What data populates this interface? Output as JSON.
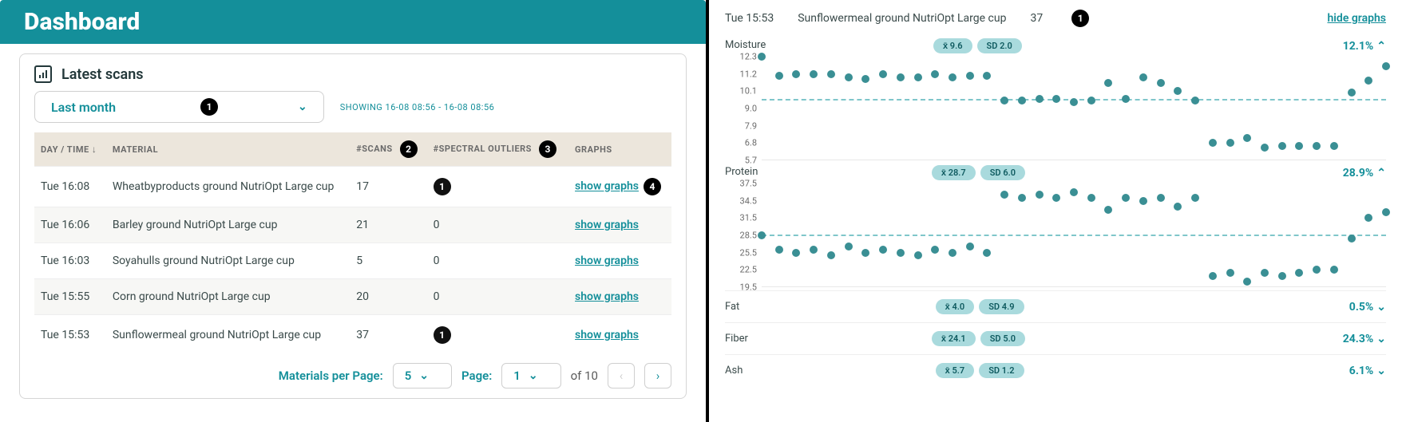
{
  "header": {
    "title": "Dashboard"
  },
  "panel": {
    "title": "Latest scans",
    "filter_label": "Last month",
    "showing_prefix": "SHOWING",
    "showing_range": "16-08 08:56 - 16-08 08:56"
  },
  "table": {
    "columns": {
      "daytime": "DAY / TIME",
      "material": "MATERIAL",
      "scans": "#SCANS",
      "outliers": "#SPECTRAL OUTLIERS",
      "graphs": "GRAPHS"
    },
    "graph_link_label": "show graphs",
    "rows": [
      {
        "daytime": "Tue 16:08",
        "material": "Wheatbyproducts ground NutriOpt Large cup",
        "scans": 17,
        "outliers": 1,
        "outlier_badge": true
      },
      {
        "daytime": "Tue 16:06",
        "material": "Barley ground NutriOpt Large cup",
        "scans": 21,
        "outliers": 0,
        "outlier_badge": false
      },
      {
        "daytime": "Tue 16:03",
        "material": "Soyahulls ground NutriOpt Large cup",
        "scans": 5,
        "outliers": 0,
        "outlier_badge": false
      },
      {
        "daytime": "Tue 15:55",
        "material": "Corn ground NutriOpt Large cup",
        "scans": 20,
        "outliers": 0,
        "outlier_badge": false
      },
      {
        "daytime": "Tue 15:53",
        "material": "Sunflowermeal ground NutriOpt Large cup",
        "scans": 37,
        "outliers": 1,
        "outlier_badge": true
      }
    ]
  },
  "pager": {
    "per_page_label": "Materials per Page:",
    "per_page_value": "5",
    "page_label": "Page:",
    "page_value": "1",
    "of_label": "of",
    "total_pages": "10"
  },
  "annotations": {
    "a1": "1",
    "a2": "2",
    "a3": "3",
    "a4": "4",
    "det_badge": "1"
  },
  "detail": {
    "daytime": "Tue 15:53",
    "material": "Sunflowermeal ground NutriOpt Large cup",
    "scans": "37",
    "hide_label": "hide graphs"
  },
  "charts": {
    "moisture": {
      "title": "Moisture",
      "mean_label": "x̄ 9.6",
      "sd_label": "SD 2.0",
      "summary": "12.1%",
      "y_ticks": [
        "12.3",
        "11.2",
        "10.1",
        "9.0",
        "7.9",
        "6.8",
        "5.7"
      ]
    },
    "protein": {
      "title": "Protein",
      "mean_label": "x̄ 28.7",
      "sd_label": "SD 6.0",
      "summary": "28.9%",
      "y_ticks": [
        "37.5",
        "34.5",
        "31.5",
        "28.5",
        "25.5",
        "22.5",
        "19.5"
      ]
    },
    "fat": {
      "title": "Fat",
      "mean_label": "x̄ 4.0",
      "sd_label": "SD 4.9",
      "summary": "0.5%"
    },
    "fiber": {
      "title": "Fiber",
      "mean_label": "x̄ 24.1",
      "sd_label": "SD 5.0",
      "summary": "24.3%"
    },
    "ash": {
      "title": "Ash",
      "mean_label": "x̄ 5.7",
      "sd_label": "SD 1.2",
      "summary": "6.1%"
    }
  },
  "chart_data": [
    {
      "type": "scatter",
      "title": "Moisture",
      "ylabel": "Moisture",
      "ylim": [
        5.7,
        12.3
      ],
      "mean": 9.6,
      "sd": 2.0,
      "x": [
        1,
        2,
        3,
        4,
        5,
        6,
        7,
        8,
        9,
        10,
        11,
        12,
        13,
        14,
        15,
        16,
        17,
        18,
        19,
        20,
        21,
        22,
        23,
        24,
        25,
        26,
        27,
        28,
        29,
        30,
        31,
        32,
        33,
        34,
        35,
        36,
        37
      ],
      "values": [
        12.3,
        11.1,
        11.2,
        11.2,
        11.2,
        11.0,
        10.9,
        11.2,
        11.0,
        11.0,
        11.2,
        11.0,
        11.1,
        11.1,
        9.5,
        9.5,
        9.6,
        9.6,
        9.4,
        9.5,
        10.6,
        9.6,
        11.0,
        10.6,
        10.1,
        9.5,
        6.8,
        6.8,
        7.1,
        6.5,
        6.6,
        6.6,
        6.6,
        6.6,
        10.0,
        10.8,
        11.7
      ]
    },
    {
      "type": "scatter",
      "title": "Protein",
      "ylabel": "Protein",
      "ylim": [
        19.5,
        37.5
      ],
      "mean": 28.7,
      "sd": 6.0,
      "x": [
        1,
        2,
        3,
        4,
        5,
        6,
        7,
        8,
        9,
        10,
        11,
        12,
        13,
        14,
        15,
        16,
        17,
        18,
        19,
        20,
        21,
        22,
        23,
        24,
        25,
        26,
        27,
        28,
        29,
        30,
        31,
        32,
        33,
        34,
        35,
        36,
        37
      ],
      "values": [
        28.5,
        26.0,
        25.5,
        26.0,
        25.0,
        26.5,
        25.5,
        26.0,
        25.5,
        25.0,
        26.0,
        25.5,
        26.5,
        25.5,
        35.5,
        35.0,
        35.5,
        35.0,
        36.0,
        35.0,
        33.0,
        35.0,
        34.5,
        35.0,
        33.5,
        35.0,
        21.5,
        22.0,
        20.5,
        22.0,
        21.5,
        22.0,
        22.5,
        22.5,
        28.0,
        31.5,
        32.5
      ]
    }
  ]
}
